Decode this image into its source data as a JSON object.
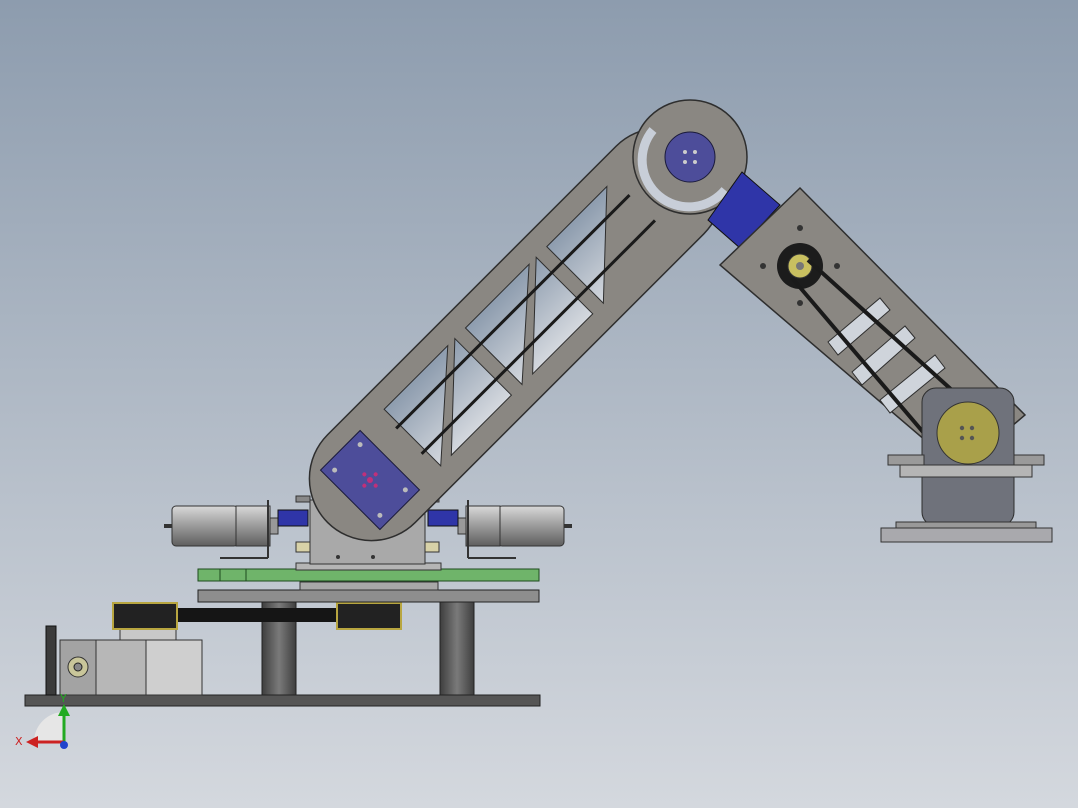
{
  "viewport": {
    "background_top": "#8d9cae",
    "background_bottom": "#d4d8de"
  },
  "colors": {
    "sheet_metal": "#8a8782",
    "sheet_metal_edge": "#2e2e2e",
    "servo_blue": "#4d4d9a",
    "connector_blue": "#2f35a8",
    "pulley_yellow": "#a9a04a",
    "belt_black": "#1a1a1a",
    "pcb_green": "#6fb46a",
    "plate_grey": "#9b9b9b",
    "base_dark": "#4f4f4f",
    "motor_silver": "#b8b8b8"
  },
  "triad": {
    "x_label": "X",
    "y_label": "Y",
    "x_color": "#cc2222",
    "y_color": "#22aa22",
    "z_color": "#2244cc"
  },
  "icons": [
    "coordinate-triad-icon"
  ]
}
